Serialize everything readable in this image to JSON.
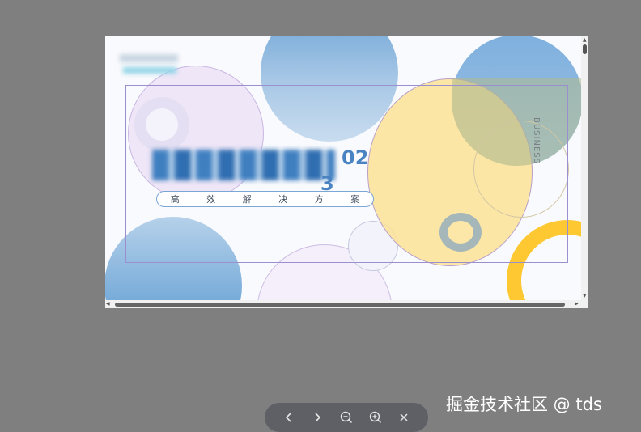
{
  "slide": {
    "subtitle": [
      "高",
      "效",
      "解",
      "决",
      "方",
      "案"
    ],
    "business": "BUSINESS",
    "year_line1": "02",
    "year_line2": "3"
  },
  "colors": {
    "background": "#7f7f7f",
    "blue": "#6aa4d6",
    "light_blue": "#b4cfe9",
    "yellow": "#fde7a8",
    "gold": "#fdc933",
    "lavender": "#efe8f8"
  },
  "toolbar": {
    "icons": [
      "chevron-left-icon",
      "chevron-right-icon",
      "zoom-out-icon",
      "zoom-in-icon",
      "close-icon"
    ]
  },
  "watermark": "掘金技术社区 @ tds"
}
